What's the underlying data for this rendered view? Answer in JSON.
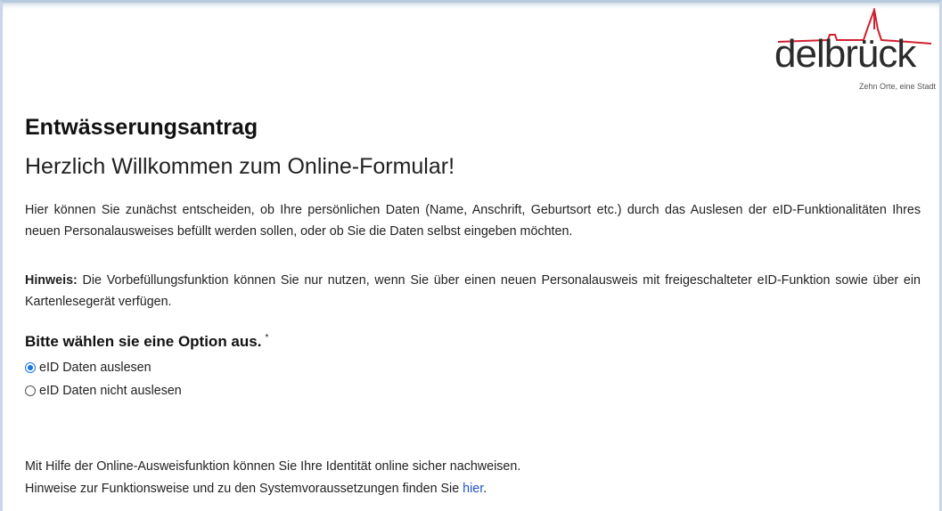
{
  "logo": {
    "name": "delbrück",
    "tagline": "Zehn Orte, eine Stadt",
    "accent_color": "#d1202f"
  },
  "page": {
    "title": "Entwässerungsantrag",
    "subtitle": "Herzlich Willkommen zum Online-Formular!"
  },
  "intro": {
    "text": "Hier können Sie zunächst entscheiden, ob Ihre persönlichen Daten (Name, Anschrift, Geburtsort etc.) durch das Auslesen der eID-Funktionalitäten Ihres neuen Personalausweises befüllt werden sollen, oder ob Sie die Daten selbst eingeben möchten."
  },
  "note": {
    "label": "Hinweis:",
    "text": " Die Vorbefüllungsfunktion können Sie nur nutzen, wenn Sie über einen neuen Personalausweis mit freigeschalteter eID-Funktion sowie über ein Kartenlesegerät verfügen."
  },
  "options": {
    "title": "Bitte wählen sie eine Option aus.",
    "required_marker": "*",
    "items": [
      {
        "label": "eID Daten auslesen",
        "checked": true
      },
      {
        "label": "eID Daten nicht auslesen",
        "checked": false
      }
    ]
  },
  "info": {
    "line1": "Mit Hilfe der Online-Ausweisfunktion können Sie Ihre Identität online sicher nachweisen.",
    "line2_text": "Hinweise zur Funktionsweise und zu den Systemvoraussetzungen finden Sie ",
    "link_label": "hier",
    "line2_end": "."
  },
  "colors": {
    "link": "#1f55c6",
    "radio_selected": "#1a73e8"
  }
}
